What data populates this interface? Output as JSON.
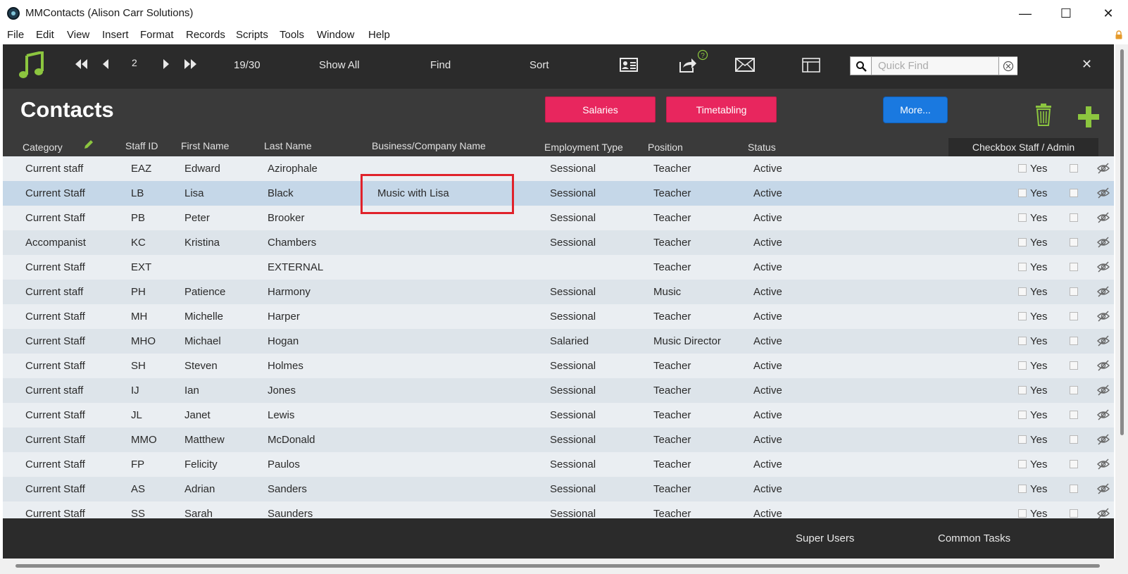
{
  "window": {
    "title": "MMContacts (Alison Carr Solutions)",
    "minimize_glyph": "—",
    "maximize_glyph": "☐",
    "close_glyph": "✕"
  },
  "menu": [
    "File",
    "Edit",
    "View",
    "Insert",
    "Format",
    "Records",
    "Scripts",
    "Tools",
    "Window",
    "Help"
  ],
  "toolbar": {
    "record_number": "2",
    "record_count": "19/30",
    "show_all": "Show All",
    "find": "Find",
    "sort": "Sort",
    "quick_find_placeholder": "Quick Find",
    "close_glyph": "✕"
  },
  "header": {
    "title": "Contacts",
    "salaries": "Salaries",
    "timetabling": "Timetabling",
    "more": "More...",
    "columns": {
      "category": "Category",
      "staff_id": "Staff ID",
      "first_name": "First Name",
      "last_name": "Last Name",
      "company": "Business/Company Name",
      "employment_type": "Employment Type",
      "position": "Position",
      "status": "Status",
      "checkbox_staff_admin": "Checkbox Staff / Admin"
    }
  },
  "rows": [
    {
      "category": "Current staff",
      "id": "EAZ",
      "first": "Edward",
      "last": "Azirophale",
      "company": "",
      "employment": "Sessional",
      "position": "Teacher",
      "status": "Active",
      "yes": "Yes"
    },
    {
      "category": "Current Staff",
      "id": "LB",
      "first": "Lisa",
      "last": "Black",
      "company": "Music with Lisa",
      "employment": "Sessional",
      "position": "Teacher",
      "status": "Active",
      "yes": "Yes"
    },
    {
      "category": "Current Staff",
      "id": "PB",
      "first": "Peter",
      "last": "Brooker",
      "company": "",
      "employment": "Sessional",
      "position": "Teacher",
      "status": "Active",
      "yes": "Yes"
    },
    {
      "category": "Accompanist",
      "id": "KC",
      "first": "Kristina",
      "last": "Chambers",
      "company": "",
      "employment": "Sessional",
      "position": "Teacher",
      "status": "Active",
      "yes": "Yes"
    },
    {
      "category": "Current Staff",
      "id": "EXT",
      "first": "",
      "last": "EXTERNAL",
      "company": "",
      "employment": "",
      "position": "Teacher",
      "status": "Active",
      "yes": "Yes"
    },
    {
      "category": "Current staff",
      "id": "PH",
      "first": "Patience",
      "last": "Harmony",
      "company": "",
      "employment": "Sessional",
      "position": "Music",
      "status": "Active",
      "yes": "Yes"
    },
    {
      "category": "Current Staff",
      "id": "MH",
      "first": "Michelle",
      "last": "Harper",
      "company": "",
      "employment": "Sessional",
      "position": "Teacher",
      "status": "Active",
      "yes": "Yes"
    },
    {
      "category": "Current Staff",
      "id": "MHO",
      "first": "Michael",
      "last": "Hogan",
      "company": "",
      "employment": "Salaried",
      "position": "Music Director",
      "status": "Active",
      "yes": "Yes"
    },
    {
      "category": "Current Staff",
      "id": "SH",
      "first": "Steven",
      "last": "Holmes",
      "company": "",
      "employment": "Sessional",
      "position": "Teacher",
      "status": "Active",
      "yes": "Yes"
    },
    {
      "category": "Current staff",
      "id": "IJ",
      "first": "Ian",
      "last": "Jones",
      "company": "",
      "employment": "Sessional",
      "position": "Teacher",
      "status": "Active",
      "yes": "Yes"
    },
    {
      "category": "Current Staff",
      "id": "JL",
      "first": "Janet",
      "last": "Lewis",
      "company": "",
      "employment": "Sessional",
      "position": "Teacher",
      "status": "Active",
      "yes": "Yes"
    },
    {
      "category": "Current Staff",
      "id": "MMO",
      "first": "Matthew",
      "last": "McDonald",
      "company": "",
      "employment": "Sessional",
      "position": "Teacher",
      "status": "Active",
      "yes": "Yes"
    },
    {
      "category": "Current Staff",
      "id": "FP",
      "first": "Felicity",
      "last": "Paulos",
      "company": "",
      "employment": "Sessional",
      "position": "Teacher",
      "status": "Active",
      "yes": "Yes"
    },
    {
      "category": "Current Staff",
      "id": "AS",
      "first": "Adrian",
      "last": "Sanders",
      "company": "",
      "employment": "Sessional",
      "position": "Teacher",
      "status": "Active",
      "yes": "Yes"
    },
    {
      "category": "Current Staff",
      "id": "SS",
      "first": "Sarah",
      "last": "Saunders",
      "company": "",
      "employment": "Sessional",
      "position": "Teacher",
      "status": "Active",
      "yes": "Yes"
    }
  ],
  "selected_row": 1,
  "footer": {
    "super_users": "Super Users",
    "common_tasks": "Common Tasks"
  },
  "colors": {
    "toolbar_bg": "#2b2b2b",
    "header_bg": "#3a3a3a",
    "accent_pink": "#e8265e",
    "accent_blue": "#1a79e0",
    "accent_green": "#8cc63f",
    "selected_row": "#c5d7e8",
    "highlight_box": "#e0222b"
  }
}
